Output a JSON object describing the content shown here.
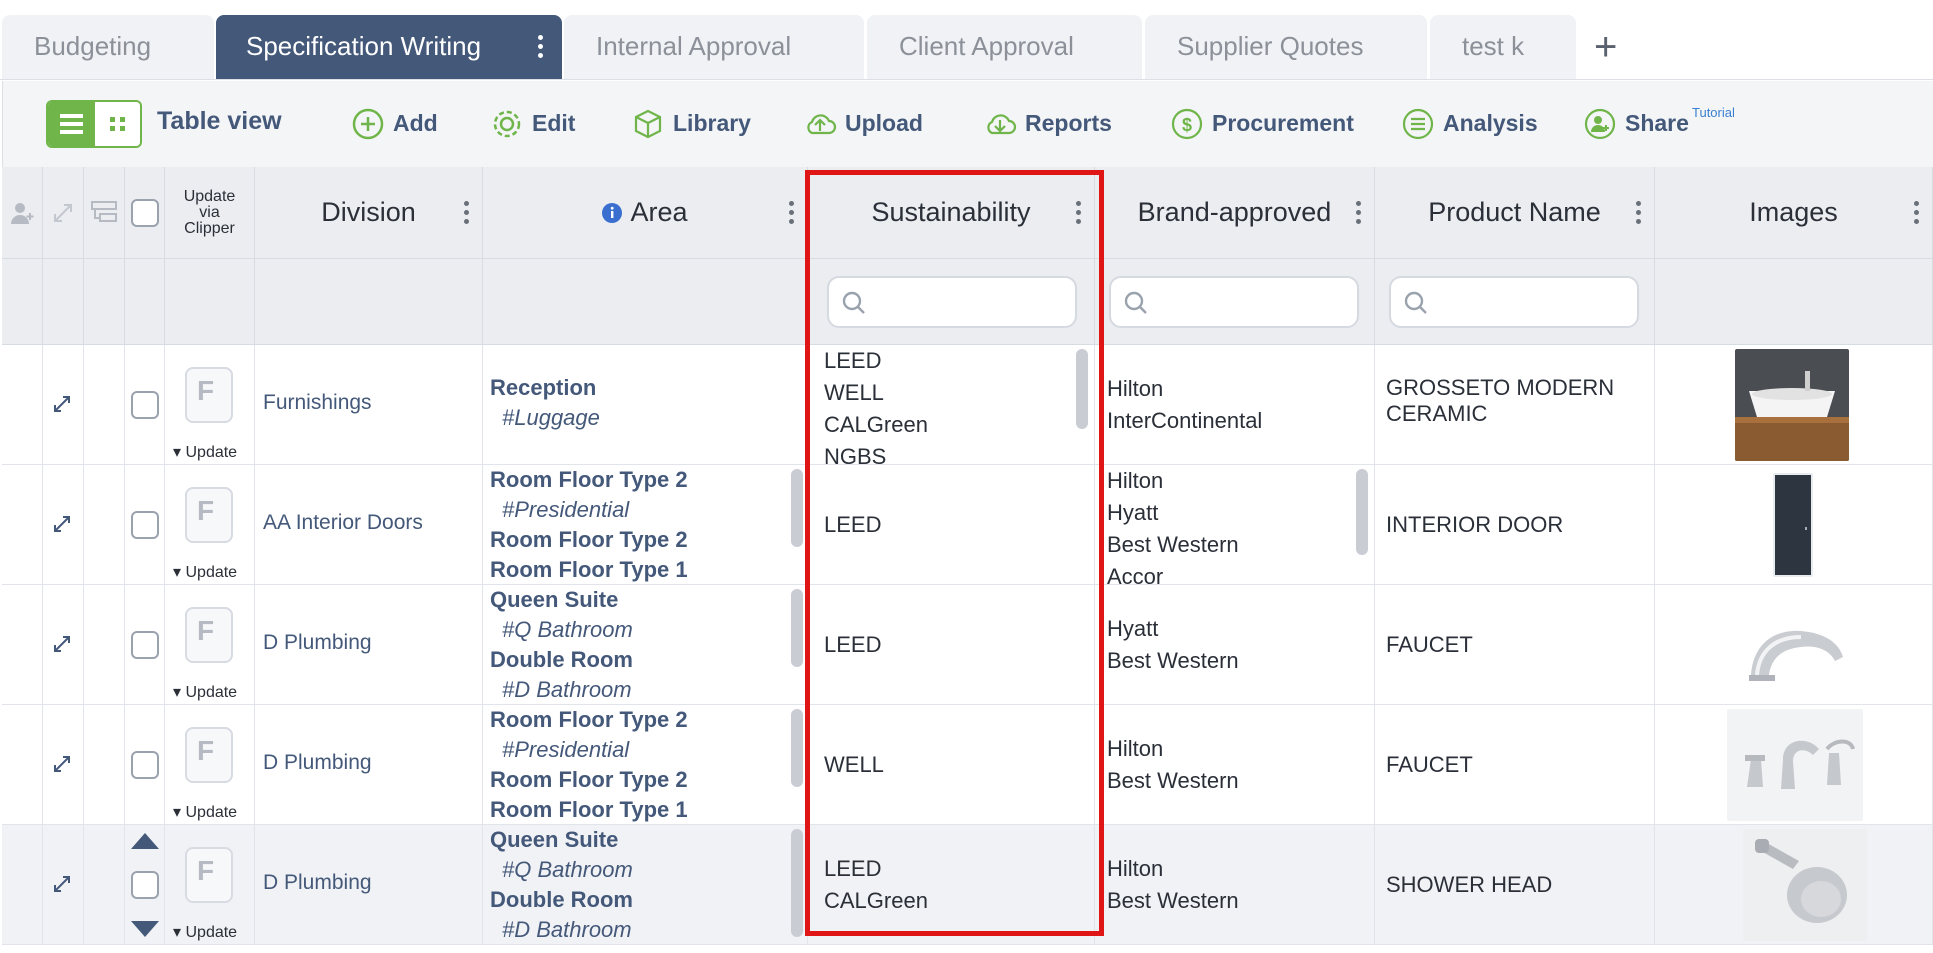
{
  "tabs": [
    {
      "label": "Budgeting",
      "active": false
    },
    {
      "label": "Specification Writing",
      "active": true
    },
    {
      "label": "Internal Approval",
      "active": false
    },
    {
      "label": "Client Approval",
      "active": false
    },
    {
      "label": "Supplier Quotes",
      "active": false
    },
    {
      "label": "test k",
      "active": false
    }
  ],
  "toolbar": {
    "view_label": "Table view",
    "items": [
      {
        "label": "Add",
        "icon": "plus-circle-icon"
      },
      {
        "label": "Edit",
        "icon": "gear-icon"
      },
      {
        "label": "Library",
        "icon": "cube-icon"
      },
      {
        "label": "Upload",
        "icon": "cloud-upload-icon"
      },
      {
        "label": "Reports",
        "icon": "cloud-download-icon"
      },
      {
        "label": "Procurement",
        "icon": "dollar-circle-icon"
      },
      {
        "label": "Analysis",
        "icon": "list-circle-icon"
      },
      {
        "label": "Share",
        "icon": "user-add-icon"
      }
    ],
    "tutorial": "Tutorial"
  },
  "columns": {
    "update_via_clipper": [
      "Update",
      "via",
      "Clipper"
    ],
    "division": "Division",
    "area": "Area",
    "sustainability": "Sustainability",
    "brand_approved": "Brand-approved",
    "product_name": "Product Name",
    "images": "Images"
  },
  "update_label": "Update",
  "clipper_glyph": "F",
  "rows": [
    {
      "division": "Furnishings",
      "area": [
        {
          "name": "Reception",
          "tag": "#Luggage"
        }
      ],
      "sustainability": [
        "LEED",
        "WELL",
        "CALGreen",
        "NGBS"
      ],
      "brands": [
        "Hilton",
        "InterContinental"
      ],
      "product": [
        "GROSSETO MODERN",
        "CERAMIC"
      ],
      "image": "sink"
    },
    {
      "division": "AA Interior Doors",
      "area": [
        {
          "name": "Room Floor Type 2",
          "tag": "#Presidential"
        },
        {
          "name": "Room Floor Type 2",
          "tag": ""
        },
        {
          "name": "Room Floor Type 1",
          "tag": ""
        }
      ],
      "sustainability": [
        "LEED"
      ],
      "brands": [
        "Hilton",
        "Hyatt",
        "Best Western",
        "Accor"
      ],
      "product": [
        "INTERIOR DOOR"
      ],
      "image": "door"
    },
    {
      "division": "D Plumbing",
      "area": [
        {
          "name": "Queen Suite",
          "tag": "#Q Bathroom"
        },
        {
          "name": "Double Room",
          "tag": "#D Bathroom"
        }
      ],
      "sustainability": [
        "LEED"
      ],
      "brands": [
        "Hyatt",
        "Best Western"
      ],
      "product": [
        "FAUCET"
      ],
      "image": "faucet"
    },
    {
      "division": "D Plumbing",
      "area": [
        {
          "name": "Room Floor Type 2",
          "tag": "#Presidential"
        },
        {
          "name": "Room Floor Type 2",
          "tag": ""
        },
        {
          "name": "Room Floor Type 1",
          "tag": ""
        }
      ],
      "sustainability": [
        "WELL"
      ],
      "brands": [
        "Hilton",
        "Best Western"
      ],
      "product": [
        "FAUCET"
      ],
      "image": "faucet-set"
    },
    {
      "division": "D Plumbing",
      "area": [
        {
          "name": "Queen Suite",
          "tag": "#Q Bathroom"
        },
        {
          "name": "Double Room",
          "tag": "#D Bathroom"
        }
      ],
      "sustainability": [
        "LEED",
        "CALGreen"
      ],
      "brands": [
        "Hilton",
        "Best Western"
      ],
      "product": [
        "SHOWER HEAD"
      ],
      "image": "shower"
    }
  ],
  "colors": {
    "accent": "#44587a",
    "green": "#6fb54a",
    "highlight": "#e01515"
  }
}
